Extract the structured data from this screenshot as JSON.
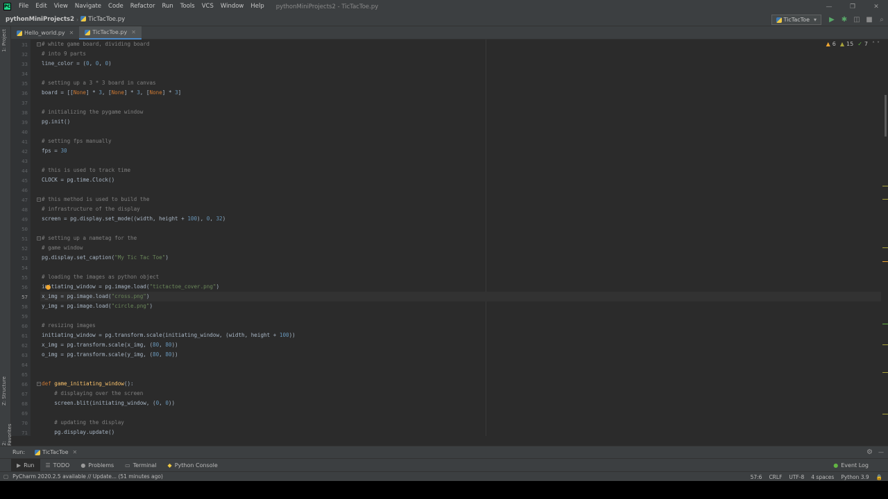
{
  "app": {
    "logo": "PC",
    "window_title": "pythonMiniProjects2 - TicTacToe.py"
  },
  "menu": [
    "File",
    "Edit",
    "View",
    "Navigate",
    "Code",
    "Refactor",
    "Run",
    "Tools",
    "VCS",
    "Window",
    "Help"
  ],
  "window_controls": {
    "minimize": "—",
    "restore": "❐",
    "close": "✕"
  },
  "breadcrumb": {
    "project": "pythonMiniProjects2",
    "file": "TicTacToe.py"
  },
  "run_config": {
    "label": "TicTacToe",
    "icon": "dropdown-arrow"
  },
  "toolbar_icons": [
    "run-icon",
    "debug-icon",
    "coverage-icon",
    "stop-icon",
    "search-icon"
  ],
  "left_stripe": {
    "project": "1: Project",
    "structure": "Z: Structure",
    "favorites": "2: Favorites"
  },
  "tabs": [
    {
      "label": "Hello_world.py",
      "active": false
    },
    {
      "label": "TicTacToe.py",
      "active": true
    }
  ],
  "inspections": {
    "warnings": "6",
    "weak": "15",
    "ok": "7"
  },
  "editor": {
    "lines": [
      {
        "n": "31",
        "t": "com",
        "text": "# white game board, dividing board"
      },
      {
        "n": "32",
        "t": "com",
        "text": "# into 9 parts"
      },
      {
        "n": "33",
        "t": "txt",
        "text": "line_color = (0, 0, 0)"
      },
      {
        "n": "34",
        "t": "txt",
        "text": ""
      },
      {
        "n": "35",
        "t": "com",
        "text": "# setting up a 3 * 3 board in canvas"
      },
      {
        "n": "36",
        "t": "txt",
        "text": "board = [[None] * 3, [None] * 3, [None] * 3]"
      },
      {
        "n": "37",
        "t": "txt",
        "text": ""
      },
      {
        "n": "38",
        "t": "com",
        "text": "# initializing the pygame window"
      },
      {
        "n": "39",
        "t": "txt",
        "text": "pg.init()"
      },
      {
        "n": "40",
        "t": "txt",
        "text": ""
      },
      {
        "n": "41",
        "t": "com",
        "text": "# setting fps manually"
      },
      {
        "n": "42",
        "t": "txt",
        "text": "fps = 30"
      },
      {
        "n": "43",
        "t": "txt",
        "text": ""
      },
      {
        "n": "44",
        "t": "com",
        "text": "# this is used to track time"
      },
      {
        "n": "45",
        "t": "txt",
        "text": "CLOCK = pg.time.Clock()"
      },
      {
        "n": "46",
        "t": "txt",
        "text": ""
      },
      {
        "n": "47",
        "t": "com",
        "text": "# this method is used to build the"
      },
      {
        "n": "48",
        "t": "com",
        "text": "# infrastructure of the display"
      },
      {
        "n": "49",
        "t": "txt",
        "text": "screen = pg.display.set_mode((width, height + 100), 0, 32)"
      },
      {
        "n": "50",
        "t": "txt",
        "text": ""
      },
      {
        "n": "51",
        "t": "com",
        "text": "# setting up a nametag for the"
      },
      {
        "n": "52",
        "t": "com",
        "text": "# game window"
      },
      {
        "n": "53",
        "t": "txt",
        "text": "pg.display.set_caption(\"My Tic Tac Toe\")"
      },
      {
        "n": "54",
        "t": "txt",
        "text": ""
      },
      {
        "n": "55",
        "t": "com",
        "text": "# loading the images as python object"
      },
      {
        "n": "56",
        "t": "txt",
        "text": "initiating_window = pg.image.load(\"tictactoe_cover.png\")"
      },
      {
        "n": "57",
        "t": "txt",
        "text": "x_img = pg.image.load(\"cross.png\")"
      },
      {
        "n": "58",
        "t": "txt",
        "text": "y_img = pg.image.load(\"circle.png\")"
      },
      {
        "n": "59",
        "t": "txt",
        "text": ""
      },
      {
        "n": "60",
        "t": "com",
        "text": "# resizing images"
      },
      {
        "n": "61",
        "t": "txt",
        "text": "initiating_window = pg.transform.scale(initiating_window, (width, height + 100))"
      },
      {
        "n": "62",
        "t": "txt",
        "text": "x_img = pg.transform.scale(x_img, (80, 80))"
      },
      {
        "n": "63",
        "t": "txt",
        "text": "o_img = pg.transform.scale(y_img, (80, 80))"
      },
      {
        "n": "64",
        "t": "txt",
        "text": ""
      },
      {
        "n": "65",
        "t": "txt",
        "text": ""
      },
      {
        "n": "66",
        "t": "def",
        "text": "def game_initiating_window():"
      },
      {
        "n": "67",
        "t": "com",
        "text": "    # displaying over the screen"
      },
      {
        "n": "68",
        "t": "txt",
        "text": "    screen.blit(initiating_window, (0, 0))"
      },
      {
        "n": "69",
        "t": "txt",
        "text": ""
      },
      {
        "n": "70",
        "t": "com",
        "text": "    # updating the display"
      },
      {
        "n": "71",
        "t": "txt",
        "text": "    pg.display.update()"
      }
    ],
    "current_line": "57"
  },
  "run_panel": {
    "label": "Run:",
    "tab": "TicTacToe"
  },
  "tool_windows": [
    {
      "label": "Run",
      "icon": "play-icon"
    },
    {
      "label": "TODO",
      "icon": "list-icon"
    },
    {
      "label": "Problems",
      "icon": "warning-icon"
    },
    {
      "label": "Terminal",
      "icon": "terminal-icon"
    },
    {
      "label": "Python Console",
      "icon": "python-icon"
    }
  ],
  "event_log": "Event Log",
  "status": {
    "message": "PyCharm 2020.2.5 available // Update... (51 minutes ago)",
    "position": "57:6",
    "line_sep": "CRLF",
    "encoding": "UTF-8",
    "indent": "4 spaces",
    "interpreter": "Python 3.9"
  },
  "colors": {
    "comment": "#808080",
    "text": "#a9b7c6",
    "number": "#6897bb",
    "string": "#6a8759",
    "keyword": "#cc7832",
    "function": "#ffc66d"
  }
}
